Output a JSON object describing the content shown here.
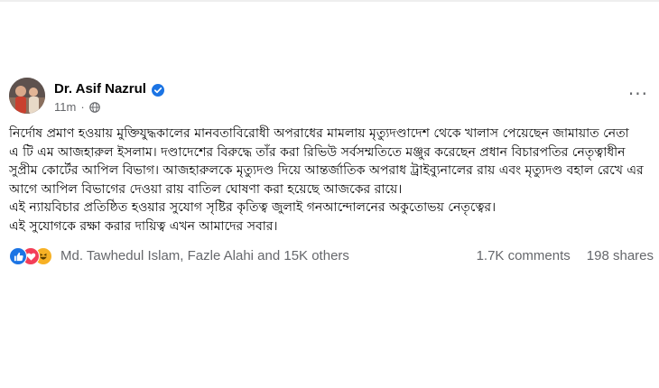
{
  "post": {
    "author": "Dr. Asif Nazrul",
    "time": "11m",
    "separator": "·",
    "more_label": "···",
    "lines": [
      "নির্দোষ প্রমাণ হওয়ায় মুক্তিযুদ্ধকালের মানবতাবিরোধী অপরাধের মামলায় মৃত্যুদণ্ডাদেশ থেকে খালাস পেয়েছেন জামায়াত নেতা",
      "এ টি এম আজহারুল ইসলাম। দণ্ডাদেশের বিরুদ্ধে তাঁর করা রিভিউ সর্বসম্মতিতে মঞ্জুর করেছেন প্রধান বিচারপতির নেতৃত্বাধীন",
      "সুপ্রীম কোর্টের আপিল বিভাগ। আজহারুলকে মৃত্যুদণ্ড দিয়ে আন্তর্জাতিক অপরাধ ট্রাইব্যুনালের রায় এবং মৃত্যুদণ্ড বহাল রেখে এর",
      "আগে আপিল বিভাগের দেওয়া রায় বাতিল ঘোষণা করা হয়েছে আজকের রায়ে।",
      "এই ন্যায়বিচার প্রতিষ্ঠিত হওয়ার সুযোগ সৃষ্টির কৃতিত্ব জুলাই গনআন্দোলনের অকুতোভয় নেতৃত্বের।",
      "এই সুযোগকে রক্ষা করার দায়িত্ব এখন আমাদের সবার।"
    ]
  },
  "footer": {
    "reactors": "Md. Tawhedul Islam, Fazle Alahi and 15K others",
    "comments": "1.7K comments",
    "shares": "198 shares"
  },
  "icons": {
    "verified": "verified-badge-icon",
    "audience": "globe-icon",
    "reactions": [
      "like-icon",
      "love-icon",
      "haha-icon"
    ]
  },
  "colors": {
    "verified": "#1b74e4",
    "secondary_text": "#65676b",
    "like": "#1b74e4",
    "love": "#f33e58",
    "haha": "#f7b125"
  }
}
